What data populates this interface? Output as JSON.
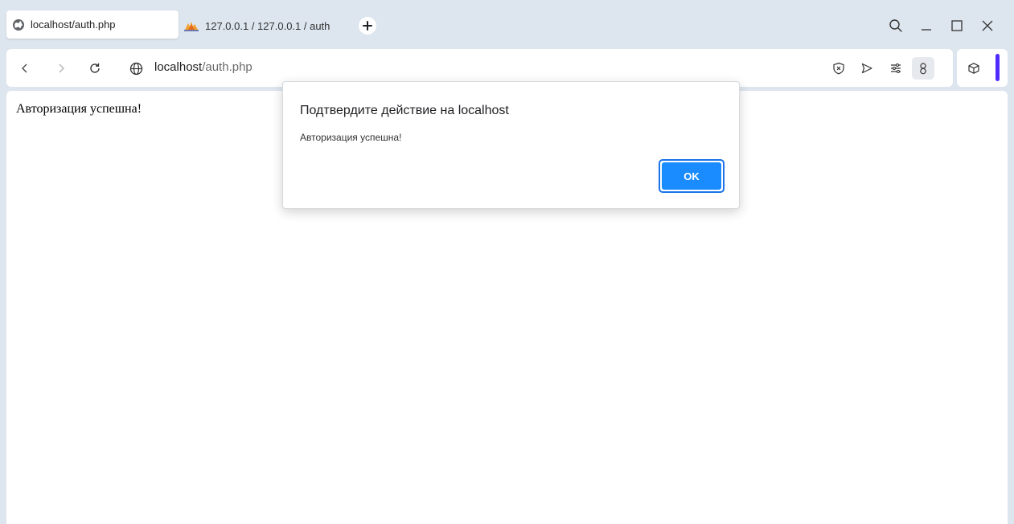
{
  "tabs": [
    {
      "title": "localhost/auth.php",
      "active": true,
      "icon": "globe-icon"
    },
    {
      "title": "127.0.0.1 / 127.0.0.1 / auth",
      "active": false,
      "icon": "phpmyadmin-icon"
    }
  ],
  "address_bar": {
    "host": "localhost",
    "path": "/auth.php"
  },
  "page": {
    "body_text": "Авторизация успешна!"
  },
  "dialog": {
    "title": "Подтвердите действие на localhost",
    "message": "Авторизация успешна!",
    "ok_label": "OK"
  },
  "colors": {
    "accent": "#1a73e8",
    "ok_button": "#1a8cff",
    "side_accent": "#4f2bff",
    "chrome_background": "#dde5ee"
  }
}
